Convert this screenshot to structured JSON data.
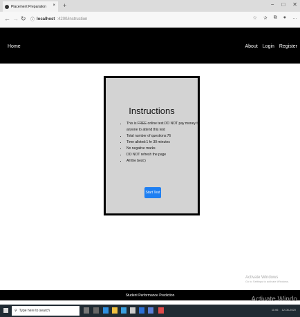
{
  "browser": {
    "tab_title": "Placement Preparation",
    "tab_close": "×",
    "new_tab": "+",
    "url_host": "localhost",
    "url_path": ":4200/instruction",
    "minimize": "−",
    "maximize": "□",
    "close": "✕"
  },
  "navbar": {
    "brand": "Home",
    "links": [
      "About",
      "Login",
      "Register"
    ]
  },
  "instructions": {
    "title": "Instructions",
    "items": [
      "This is FREE online test.DO NOT pay money to anyone to attend this test",
      "Total number of questions:76",
      "Time alloted:1 hr 30 minutes",
      "No negative marks",
      "DO NOT refresh the page",
      "All the best:)"
    ],
    "start_button": "Start Test"
  },
  "footer": {
    "text": "Student Performance Prediction"
  },
  "watermark": {
    "title": "Activate Windows",
    "subtitle": "Go to Settings to activate Windows.",
    "overlay": "Activate Windo"
  },
  "taskbar": {
    "search_placeholder": "Type here to search",
    "time": "11:06",
    "date": "12-08-2020"
  },
  "colors": {
    "navbar": "#000000",
    "card": "#d3d3d3",
    "button": "#1e7ff2",
    "taskbar": "#202b33"
  }
}
